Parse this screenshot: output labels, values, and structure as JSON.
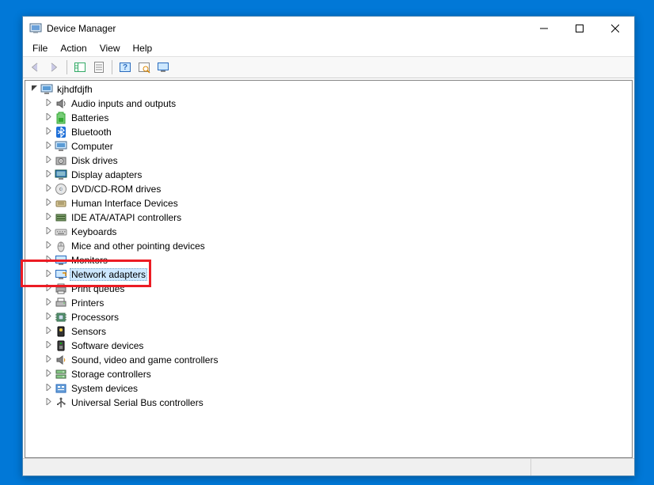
{
  "window": {
    "title": "Device Manager"
  },
  "menubar": [
    "File",
    "Action",
    "View",
    "Help"
  ],
  "toolbar": [
    {
      "name": "back",
      "icon": "arrow-left",
      "enabled": false
    },
    {
      "name": "forward",
      "icon": "arrow-right",
      "enabled": false
    },
    {
      "sep": true
    },
    {
      "name": "show-hide-tree",
      "icon": "tree-pane"
    },
    {
      "name": "properties",
      "icon": "properties"
    },
    {
      "sep": true
    },
    {
      "name": "help",
      "icon": "help"
    },
    {
      "name": "scan-hardware",
      "icon": "scan"
    },
    {
      "name": "devices-view",
      "icon": "monitor"
    }
  ],
  "tree": {
    "root": {
      "label": "kjhdfdjfh",
      "expanded": true,
      "icon": "computer"
    },
    "children": [
      {
        "label": "Audio inputs and outputs",
        "icon": "audio"
      },
      {
        "label": "Batteries",
        "icon": "battery"
      },
      {
        "label": "Bluetooth",
        "icon": "bluetooth"
      },
      {
        "label": "Computer",
        "icon": "computer"
      },
      {
        "label": "Disk drives",
        "icon": "disk"
      },
      {
        "label": "Display adapters",
        "icon": "display"
      },
      {
        "label": "DVD/CD-ROM drives",
        "icon": "cd"
      },
      {
        "label": "Human Interface Devices",
        "icon": "hid"
      },
      {
        "label": "IDE ATA/ATAPI controllers",
        "icon": "ide"
      },
      {
        "label": "Keyboards",
        "icon": "keyboard"
      },
      {
        "label": "Mice and other pointing devices",
        "icon": "mouse"
      },
      {
        "label": "Monitors",
        "icon": "monitor"
      },
      {
        "label": "Network adapters",
        "icon": "network",
        "selected": true,
        "highlighted": true
      },
      {
        "label": "Print queues",
        "icon": "printqueue"
      },
      {
        "label": "Printers",
        "icon": "printer"
      },
      {
        "label": "Processors",
        "icon": "cpu"
      },
      {
        "label": "Sensors",
        "icon": "sensor"
      },
      {
        "label": "Software devices",
        "icon": "software"
      },
      {
        "label": "Sound, video and game controllers",
        "icon": "sound"
      },
      {
        "label": "Storage controllers",
        "icon": "storage"
      },
      {
        "label": "System devices",
        "icon": "system"
      },
      {
        "label": "Universal Serial Bus controllers",
        "icon": "usb"
      }
    ]
  },
  "colors": {
    "desktop": "#0178d7",
    "highlight": "#ec1c24",
    "selection": "#cde8ff"
  }
}
